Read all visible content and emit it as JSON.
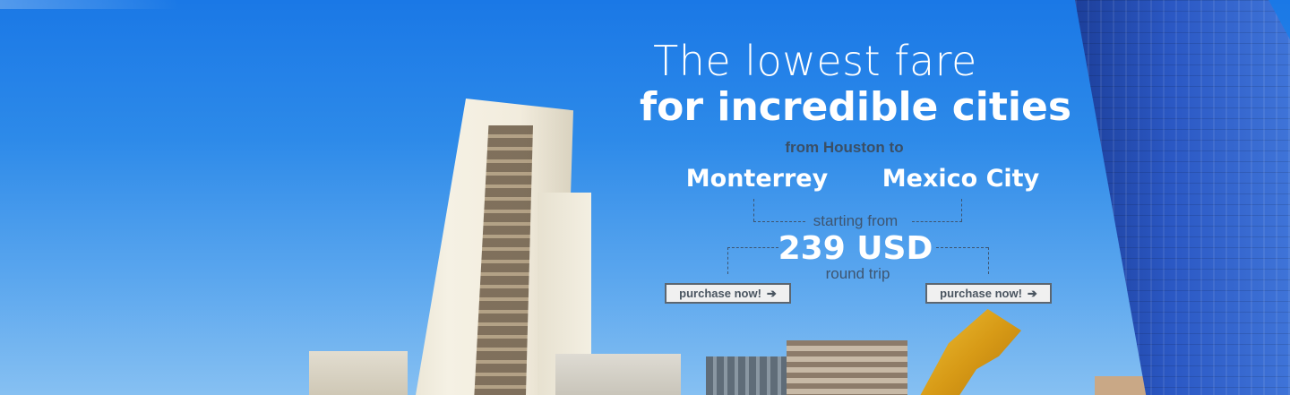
{
  "banner": {
    "headline_light": "The lowest fare",
    "headline_bold": "for incredible cities",
    "from_text": "from Houston to",
    "destinations": [
      {
        "city": "Monterrey",
        "button_label": "purchase now!",
        "button_icon": "arrow-right-icon"
      },
      {
        "city": "Mexico City",
        "button_label": "purchase now!",
        "button_icon": "arrow-right-icon"
      }
    ],
    "starting_from": "starting from",
    "price": "239 USD",
    "trip_type": "round trip"
  },
  "colors": {
    "sky_top": "#1a78e6",
    "sky_bottom": "#86c0f2",
    "text_white": "#ffffff",
    "text_dark": "#3e5570",
    "button_bg": "#f0f0f0",
    "button_border": "#5c6670"
  }
}
